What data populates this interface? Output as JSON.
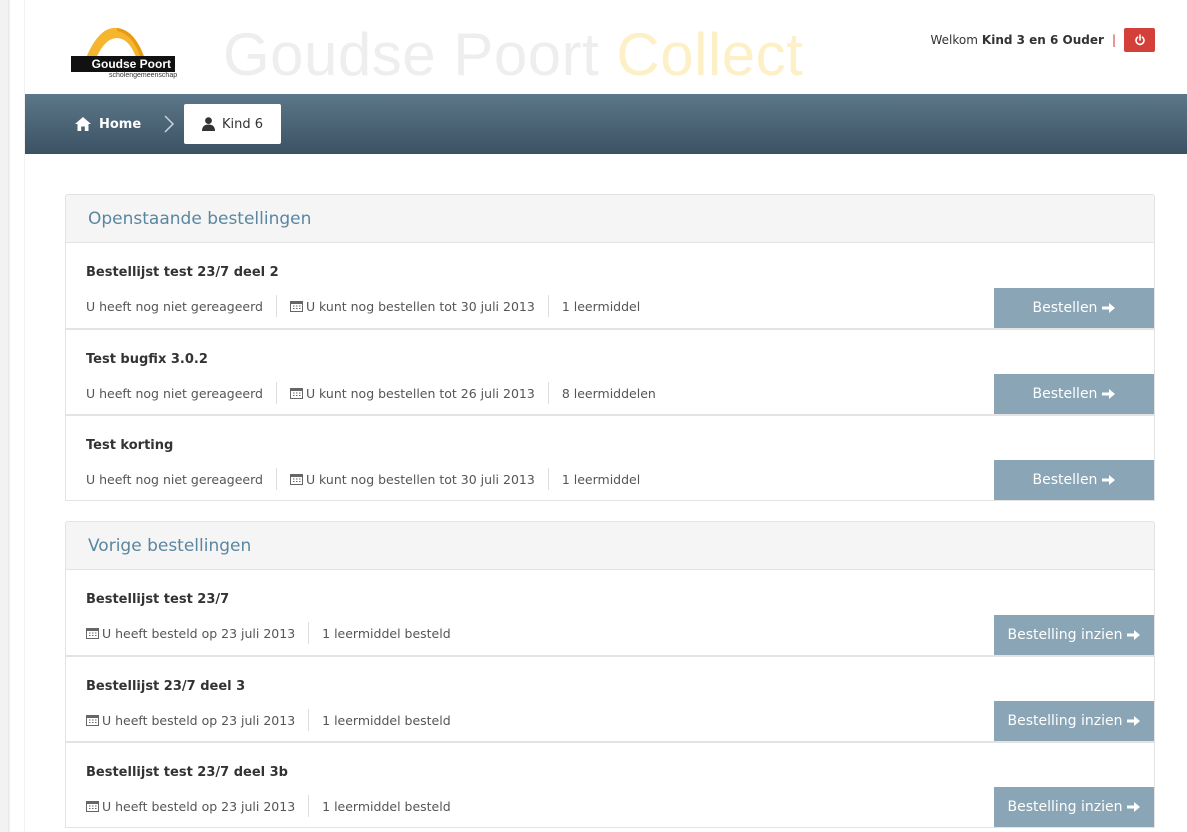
{
  "header": {
    "logo_text": "Goudse Poort",
    "logo_sub": "scholengemeenschap",
    "brand_main": "Goudse Poort",
    "brand_accent": "Collect",
    "welcome": "Welkom",
    "user_name": "Kind 3 en 6 Ouder",
    "separator": "|",
    "logout_icon": "power-icon"
  },
  "nav": {
    "home": "Home",
    "current": "Kind 6"
  },
  "open_orders": {
    "title": "Openstaande bestellingen",
    "button_label": "Bestellen",
    "items": [
      {
        "title": "Bestellijst test 23/7 deel 2",
        "status": "U heeft nog niet gereageerd",
        "deadline": "U kunt nog bestellen tot 30 juli 2013",
        "count": "1 leermiddel"
      },
      {
        "title": "Test bugfix 3.0.2",
        "status": "U heeft nog niet gereageerd",
        "deadline": "U kunt nog bestellen tot 26 juli 2013",
        "count": "8 leermiddelen"
      },
      {
        "title": "Test korting",
        "status": "U heeft nog niet gereageerd",
        "deadline": "U kunt nog bestellen tot 30 juli 2013",
        "count": "1 leermiddel"
      }
    ]
  },
  "previous_orders": {
    "title": "Vorige bestellingen",
    "button_label": "Bestelling inzien",
    "items": [
      {
        "title": "Bestellijst test 23/7",
        "ordered": "U heeft besteld op 23 juli 2013",
        "count": "1 leermiddel besteld"
      },
      {
        "title": "Bestellijst 23/7 deel 3",
        "ordered": "U heeft besteld op 23 juli 2013",
        "count": "1 leermiddel besteld"
      },
      {
        "title": "Bestellijst test 23/7 deel 3b",
        "ordered": "U heeft besteld op 23 juli 2013",
        "count": "1 leermiddel besteld"
      }
    ]
  },
  "colors": {
    "nav_top": "#5c7789",
    "nav_bottom": "#3b5263",
    "button": "#8aa5b6",
    "logout": "#d43f3a",
    "section_title": "#5a86a0"
  }
}
